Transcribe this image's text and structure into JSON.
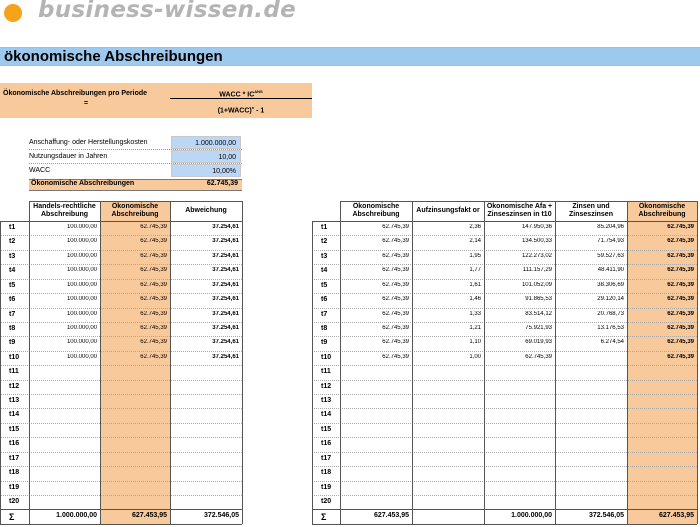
{
  "brand": {
    "name": "business-wissen.de"
  },
  "sheet": {
    "title": "ökonomische Abschreibungen"
  },
  "formula": {
    "label": "Ökonomische Abschreibungen pro Periode",
    "equals": "=",
    "numerator": "WACC * IC",
    "numerator_sup": "ANS",
    "denominator": "(1+WACC)",
    "denominator_sup": "n",
    "denominator_tail": " - 1"
  },
  "inputs": [
    {
      "label": "Anschaffung- oder Herstellungskosten",
      "value": "1.000.000,00"
    },
    {
      "label": "Nutzungsdauer in Jahren",
      "value": "10,00"
    },
    {
      "label": "WACC",
      "value": "10,00%"
    }
  ],
  "result": {
    "label": "Ökonomische Abschreibungen",
    "value": "62.745,39"
  },
  "left_table": {
    "headers": [
      "Handels-rechtliche Abschreibung",
      "Ökonomische Abschreibung",
      "Abweichung"
    ],
    "rows": [
      [
        "t1",
        "100.000,00",
        "62.745,39",
        "37.254,61"
      ],
      [
        "t2",
        "100.000,00",
        "62.745,39",
        "37.254,61"
      ],
      [
        "t3",
        "100.000,00",
        "62.745,39",
        "37.254,61"
      ],
      [
        "t4",
        "100.000,00",
        "62.745,39",
        "37.254,61"
      ],
      [
        "t5",
        "100.000,00",
        "62.745,39",
        "37.254,61"
      ],
      [
        "t6",
        "100.000,00",
        "62.745,39",
        "37.254,61"
      ],
      [
        "t7",
        "100.000,00",
        "62.745,39",
        "37.254,61"
      ],
      [
        "t8",
        "100.000,00",
        "62.745,39",
        "37.254,61"
      ],
      [
        "t9",
        "100.000,00",
        "62.745,39",
        "37.254,61"
      ],
      [
        "t10",
        "100.000,00",
        "62.745,39",
        "37.254,61"
      ],
      [
        "t11",
        "",
        "",
        ""
      ],
      [
        "t12",
        "",
        "",
        ""
      ],
      [
        "t13",
        "",
        "",
        ""
      ],
      [
        "t14",
        "",
        "",
        ""
      ],
      [
        "t15",
        "",
        "",
        ""
      ],
      [
        "t16",
        "",
        "",
        ""
      ],
      [
        "t17",
        "",
        "",
        ""
      ],
      [
        "t18",
        "",
        "",
        ""
      ],
      [
        "t19",
        "",
        "",
        ""
      ],
      [
        "t20",
        "",
        "",
        ""
      ]
    ],
    "sum": [
      "Σ",
      "1.000.000,00",
      "627.453,95",
      "372.546,05"
    ]
  },
  "right_table": {
    "headers": [
      "Ökonomische Abschreibung",
      "Aufzinsungsfakt or",
      "Ökonomische Afa + Zinseszinsen in t10",
      "Zinsen und Zinseszinsen",
      "Ökonomische Abschreibung"
    ],
    "rows": [
      [
        "t1",
        "62.745,39",
        "2,36",
        "147.950,36",
        "85.204,96",
        "62.745,39"
      ],
      [
        "t2",
        "62.745,39",
        "2,14",
        "134.500,33",
        "71.754,93",
        "62.745,39"
      ],
      [
        "t3",
        "62.745,39",
        "1,95",
        "122.273,02",
        "59.527,63",
        "62.745,39"
      ],
      [
        "t4",
        "62.745,39",
        "1,77",
        "111.157,29",
        "48.411,90",
        "62.745,39"
      ],
      [
        "t5",
        "62.745,39",
        "1,61",
        "101.052,09",
        "38.306,69",
        "62.745,39"
      ],
      [
        "t6",
        "62.745,39",
        "1,46",
        "91.865,53",
        "29.120,14",
        "62.745,39"
      ],
      [
        "t7",
        "62.745,39",
        "1,33",
        "83.514,12",
        "20.768,73",
        "62.745,39"
      ],
      [
        "t8",
        "62.745,39",
        "1,21",
        "75.921,93",
        "13.176,53",
        "62.745,39"
      ],
      [
        "t9",
        "62.745,39",
        "1,10",
        "69.019,93",
        "6.274,54",
        "62.745,39"
      ],
      [
        "t10",
        "62.745,39",
        "1,00",
        "62.745,39",
        "",
        "62.745,39"
      ],
      [
        "t11",
        "",
        "",
        "",
        "",
        ""
      ],
      [
        "t12",
        "",
        "",
        "",
        "",
        ""
      ],
      [
        "t13",
        "",
        "",
        "",
        "",
        ""
      ],
      [
        "t14",
        "",
        "",
        "",
        "",
        ""
      ],
      [
        "t15",
        "",
        "",
        "",
        "",
        ""
      ],
      [
        "t16",
        "",
        "",
        "",
        "",
        ""
      ],
      [
        "t17",
        "",
        "",
        "",
        "",
        ""
      ],
      [
        "t18",
        "",
        "",
        "",
        "",
        ""
      ],
      [
        "t19",
        "",
        "",
        "",
        "",
        ""
      ],
      [
        "t20",
        "",
        "",
        "",
        "",
        ""
      ]
    ],
    "sum": [
      "Σ",
      "627.453,95",
      "",
      "1.000.000,00",
      "372.546,05",
      "627.453,95"
    ]
  }
}
